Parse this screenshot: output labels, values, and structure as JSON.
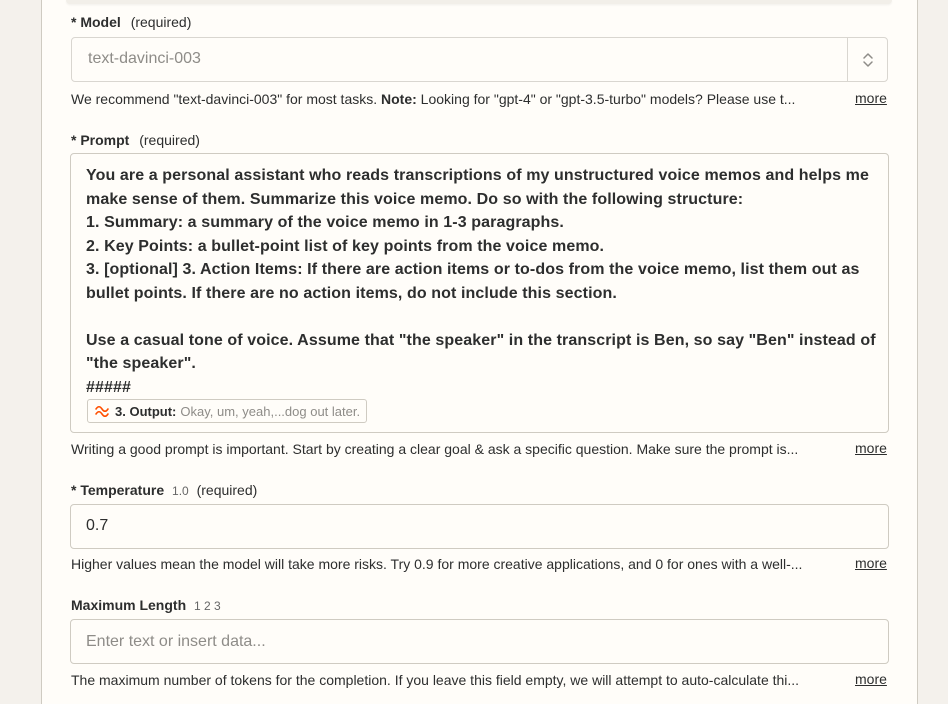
{
  "model": {
    "label": "Model",
    "required_text": "(required)",
    "value": "text-davinci-003",
    "help_prefix": "We recommend \"text-davinci-003\" for most tasks. ",
    "help_note_label": "Note:",
    "help_suffix": " Looking for \"gpt-4\" or \"gpt-3.5-turbo\" models? Please use t...",
    "more_label": "more"
  },
  "prompt": {
    "label": "Prompt",
    "required_text": "(required)",
    "lines": [
      "You are a personal assistant who reads transcriptions of my unstructured voice memos and helps me",
      "make sense of them. Summarize this voice memo. Do so with the following structure:",
      "1. Summary: a summary of the voice memo in 1-3 paragraphs.",
      "2. Key Points: a bullet-point list of key points from the voice memo.",
      "3. [optional] 3. Action Items: If there are action items or to-dos from the voice memo, list them out as",
      "bullet points. If there are no action items, do not include this section.",
      "",
      "Use a casual tone of voice. Assume that \"the speaker\" in the transcript is Ben, so say \"Ben\" instead of",
      "\"the speaker\".",
      "#####"
    ],
    "pill": {
      "icon": "openai-whisper-icon",
      "step": "3. Output:",
      "value": "Okay, um, yeah,...dog out later."
    },
    "help": "Writing a good prompt is important. Start by creating a clear goal & ask a specific question. Make sure the prompt is...",
    "more_label": "more"
  },
  "temperature": {
    "label": "Temperature",
    "version": "1.0",
    "required_text": "(required)",
    "value": "0.7",
    "help": "Higher values mean the model will take more risks. Try 0.9 for more creative applications, and 0 for ones with a well-...",
    "more_label": "more"
  },
  "max_length": {
    "label": "Maximum Length",
    "version": "1 2 3",
    "placeholder": "Enter text or insert data...",
    "help": "The maximum number of tokens for the completion. If you leave this field empty, we will attempt to auto-calculate thi...",
    "more_label": "more"
  },
  "colors": {
    "accent_orange": "#ff4f00",
    "text": "#2d2e2e",
    "muted": "#8e8c88",
    "border": "#cfcbc2"
  }
}
